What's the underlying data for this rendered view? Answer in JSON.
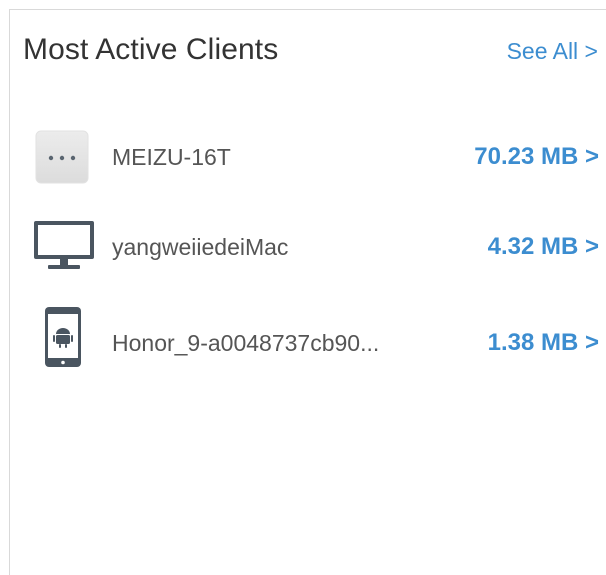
{
  "widget": {
    "title": "Most Active Clients",
    "see_all_label": "See All >"
  },
  "clients": [
    {
      "icon": "generic-device-icon",
      "name": "MEIZU-16T",
      "usage": "70.23 MB >"
    },
    {
      "icon": "desktop-computer-icon",
      "name": "yangweiiedeiMac",
      "usage": "4.32 MB >"
    },
    {
      "icon": "android-phone-icon",
      "name": "Honor_9-a0048737cb90...",
      "usage": "1.38 MB >"
    }
  ],
  "colors": {
    "accent": "#3c8dd0",
    "title": "#333333",
    "text": "#555555",
    "icon": "#4a5560"
  }
}
